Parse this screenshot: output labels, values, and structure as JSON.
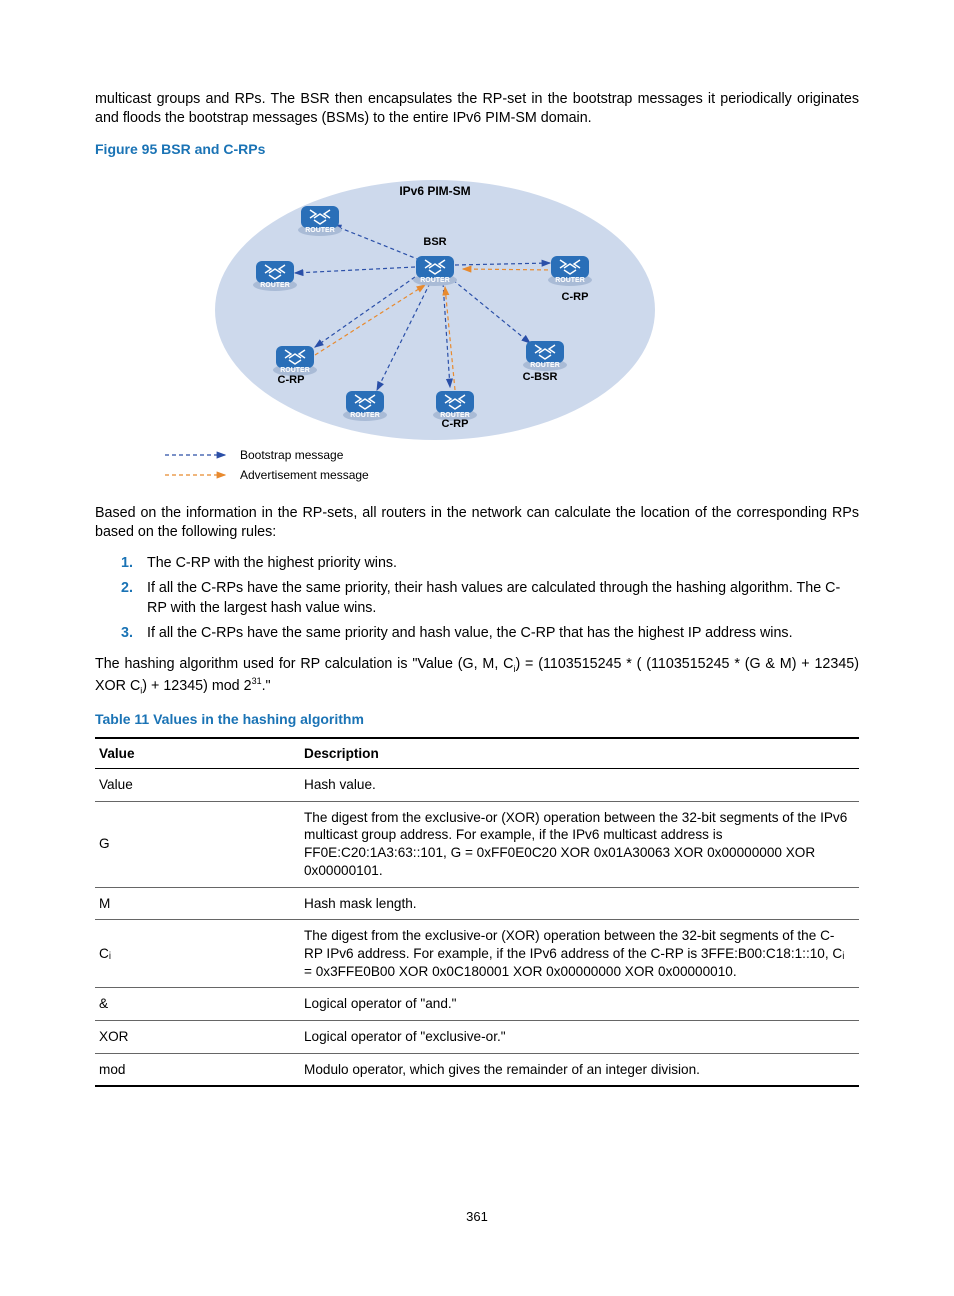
{
  "intro_para": "multicast groups and RPs. The BSR then encapsulates the RP-set in the bootstrap messages it periodically originates and floods the bootstrap messages (BSMs) to the entire IPv6 PIM-SM domain.",
  "figure_caption": "Figure 95 BSR and C-RPs",
  "diagram": {
    "title": "IPv6 PIM-SM",
    "labels": {
      "bsr": "BSR",
      "crp_tr": "C-RP",
      "cbsr": "C-BSR",
      "crp_bl": "C-RP",
      "crp_b": "C-RP"
    },
    "legend": {
      "bootstrap": "Bootstrap message",
      "advertisement": "Advertisement message"
    }
  },
  "rules_intro": "Based on the information in the RP-sets, all routers in the network can calculate the location of the corresponding RPs based on the following rules:",
  "rules": [
    "The C-RP with the highest priority wins.",
    "If all the C-RPs have the same priority, their hash values are calculated through the hashing algorithm. The C-RP with the largest hash value wins.",
    "If all the C-RPs have the same priority and hash value, the C-RP that has the highest IP address wins."
  ],
  "hash_para_prefix": "The hashing algorithm used for RP calculation is \"Value (G, M, C",
  "hash_para_mid1": ") = (1103515245 * ( (1103515245 * (G & M) + 12345) XOR C",
  "hash_para_mid2": ") + 12345) mod 2",
  "hash_para_suffix": ".\"",
  "table_caption": "Table 11 Values in the hashing algorithm",
  "table": {
    "headers": {
      "c1": "Value",
      "c2": "Description"
    },
    "rows": [
      {
        "v": "Value",
        "d": "Hash value."
      },
      {
        "v": "G",
        "d": "The digest from the exclusive-or (XOR) operation between the 32-bit segments of the IPv6 multicast group address. For example, if the IPv6 multicast address is FF0E:C20:1A3:63::101, G = 0xFF0E0C20 XOR 0x01A30063 XOR 0x00000000 XOR 0x00000101."
      },
      {
        "v": "M",
        "d": "Hash mask length."
      },
      {
        "v": "Cᵢ",
        "d": "The digest from the exclusive-or (XOR) operation between the 32-bit segments of the C-RP IPv6 address. For example, if the IPv6 address of the C-RP is 3FFE:B00:C18:1::10, Cᵢ = 0x3FFE0B00 XOR 0x0C180001 XOR 0x00000000 XOR 0x00000010."
      },
      {
        "v": "&",
        "d": "Logical operator of \"and.\""
      },
      {
        "v": "XOR",
        "d": "Logical operator of \"exclusive-or.\""
      },
      {
        "v": "mod",
        "d": "Modulo operator, which gives the remainder of an integer division."
      }
    ]
  },
  "page_number": "361"
}
